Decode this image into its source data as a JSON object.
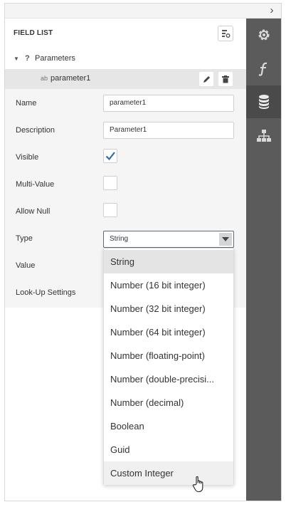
{
  "panel": {
    "title": "FIELD LIST",
    "tree_root_label": "Parameters",
    "parameter_name": "parameter1",
    "parameter_type_icon": "ab"
  },
  "properties": [
    {
      "label": "Name",
      "kind": "text",
      "value": "parameter1"
    },
    {
      "label": "Description",
      "kind": "text",
      "value": "Parameter1"
    },
    {
      "label": "Visible",
      "kind": "checkbox",
      "checked": true
    },
    {
      "label": "Multi-Value",
      "kind": "checkbox",
      "checked": false
    },
    {
      "label": "Allow Null",
      "kind": "checkbox",
      "checked": false
    },
    {
      "label": "Type",
      "kind": "select",
      "value": "String"
    },
    {
      "label": "Value",
      "kind": "label"
    },
    {
      "label": "Look-Up Settings",
      "kind": "label"
    }
  ],
  "type_options": [
    "String",
    "Number (16 bit integer)",
    "Number (32 bit integer)",
    "Number (64 bit integer)",
    "Number (floating-point)",
    "Number (double-precisi...",
    "Number (decimal)",
    "Boolean",
    "Guid",
    "Custom Integer"
  ],
  "selected_option_index": 0,
  "hovered_option_index": 9,
  "colors": {
    "rail": "#5b5b5b",
    "rail_active": "#4a4a4a",
    "check_accent": "#2f6e9e"
  },
  "rail_icons": [
    "gear-icon",
    "function-icon",
    "database-icon",
    "hierarchy-icon"
  ],
  "active_rail_index": 2
}
